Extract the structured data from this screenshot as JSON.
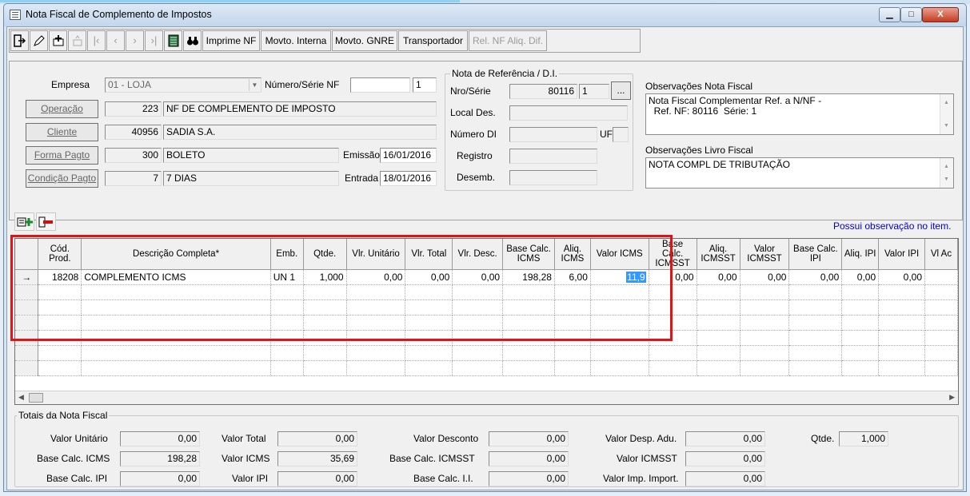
{
  "window": {
    "title": "Nota Fiscal de Complemento de Impostos",
    "min": "▁",
    "max": "□",
    "close": "X"
  },
  "toolbar": {
    "imprime": "Imprime NF",
    "movto_interna": "Movto. Interna",
    "movto_gnre": "Movto. GNRE",
    "transportador": "Transportador",
    "rel_nf": "Rel. NF Aliq. Dif."
  },
  "header": {
    "empresa_label": "Empresa",
    "empresa_value": "01 - LOJA",
    "numero_serie_label": "Número/Série NF",
    "numero_value": "",
    "serie_value": "1",
    "operacao_btn": "Operação",
    "operacao_code": "223",
    "operacao_desc": "NF DE COMPLEMENTO DE IMPOSTO",
    "cliente_btn": "Cliente",
    "cliente_code": "40956",
    "cliente_desc": "SADIA S.A.",
    "forma_pagto_btn": "Forma Pagto",
    "forma_pagto_code": "300",
    "forma_pagto_desc": "BOLETO",
    "condicao_pagto_btn": "Condição Pagto",
    "condicao_pagto_code": "7",
    "condicao_pagto_desc": "7 DIAS",
    "emissao_label": "Emissão",
    "emissao_value": "16/01/2016",
    "entrada_label": "Entrada",
    "entrada_value": "18/01/2016"
  },
  "referencia": {
    "legend": "Nota de Referência / D.I.",
    "nro_serie_label": "Nro/Série",
    "nro_value": "80116",
    "serie_value": "1",
    "lookup_btn": "...",
    "local_des_label": "Local Des.",
    "numero_di_label": "Número DI",
    "uf_label": "UF",
    "registro_label": "Registro",
    "desemb_label": "Desemb."
  },
  "observacoes": {
    "nf_label": "Observações Nota Fiscal",
    "nf_text": "Nota Fiscal Complementar Ref. a N/NF -\n  Ref. NF: 80116  Série: 1",
    "livro_label": "Observações Livro Fiscal",
    "livro_text": "NOTA COMPL DE TRIBUTAÇÃO"
  },
  "grid": {
    "note": "Possui observação no item.",
    "columns": [
      "Cód. Prod.",
      "Descrição Completa*",
      "Emb.",
      "Qtde.",
      "Vlr. Unitário",
      "Vlr. Total",
      "Vlr. Desc.",
      "Base Calc. ICMS",
      "Aliq. ICMS",
      "Valor ICMS",
      "Base Calc. ICMSST",
      "Aliq. ICMSST",
      "Valor ICMSST",
      "Base Calc. IPI",
      "Aliq. IPI",
      "Valor IPI",
      "Vl Ac"
    ],
    "row": {
      "indicator": "→",
      "cod": "18208",
      "descricao": "COMPLEMENTO ICMS",
      "emb": "UN  1",
      "qtde": "1,000",
      "vlr_unitario": "0,00",
      "vlr_total": "0,00",
      "vlr_desc": "0,00",
      "base_icms": "198,28",
      "aliq_icms": "6,00",
      "valor_icms": "11,9",
      "base_icmsst": "0,00",
      "aliq_icmsst": "0,00",
      "valor_icmsst": "0,00",
      "base_ipi": "0,00",
      "aliq_ipi": "0,00",
      "valor_ipi": "0,00"
    }
  },
  "totais": {
    "legend": "Totais da Nota Fiscal",
    "valor_unitario_label": "Valor Unitário",
    "valor_unitario": "0,00",
    "valor_total_label": "Valor Total",
    "valor_total": "0,00",
    "valor_desconto_label": "Valor Desconto",
    "valor_desconto": "0,00",
    "valor_desp_adu_label": "Valor Desp. Adu.",
    "valor_desp_adu": "0,00",
    "qtde_label": "Qtde.",
    "qtde": "1,000",
    "base_icms_label": "Base Calc. ICMS",
    "base_icms": "198,28",
    "valor_icms_label": "Valor ICMS",
    "valor_icms": "35,69",
    "base_icmsst_label": "Base Calc. ICMSST",
    "base_icmsst": "0,00",
    "valor_icmsst_label": "Valor ICMSST",
    "valor_icmsst": "0,00",
    "base_ipi_label": "Base Calc. IPI",
    "base_ipi": "0,00",
    "valor_ipi_label": "Valor IPI",
    "valor_ipi": "0,00",
    "base_ii_label": "Base Calc. I.I.",
    "base_ii": "0,00",
    "valor_imp_import_label": "Valor Imp. Import.",
    "valor_imp_import": "0,00"
  },
  "colors": {
    "highlight": "#e0131b",
    "selection": "#3399ff",
    "note": "#0000cc"
  }
}
